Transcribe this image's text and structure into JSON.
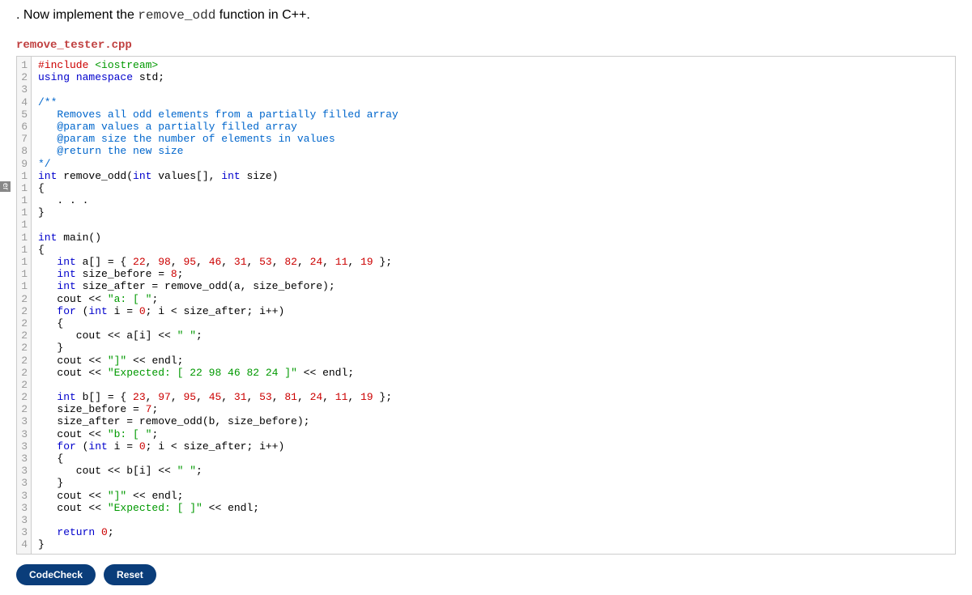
{
  "instruction_prefix": ". Now implement the ",
  "instruction_code": "remove_odd",
  "instruction_suffix": " function in C++.",
  "filename": "remove_tester.cpp",
  "sidebar_label": "er",
  "gutter_nums": [
    "1",
    "2",
    "3",
    "4",
    "5",
    "6",
    "7",
    "8",
    "9",
    "1",
    "1",
    "1",
    "1",
    "1",
    "1",
    "1",
    "1",
    "1",
    "1",
    "2",
    "2",
    "2",
    "2",
    "2",
    "2",
    "2",
    "2",
    "2",
    "2",
    "3",
    "3",
    "3",
    "3",
    "3",
    "3",
    "3",
    "3",
    "3",
    "3",
    "4"
  ],
  "code_lines": [
    {
      "segments": [
        {
          "text": "#include ",
          "cls": "kw-red"
        },
        {
          "text": "<iostream>",
          "cls": "kw-green"
        }
      ]
    },
    {
      "segments": [
        {
          "text": "using",
          "cls": "kw-blue"
        },
        {
          "text": " ",
          "cls": ""
        },
        {
          "text": "namespace",
          "cls": "kw-blue"
        },
        {
          "text": " std;",
          "cls": ""
        }
      ]
    },
    {
      "segments": []
    },
    {
      "segments": [
        {
          "text": "/**",
          "cls": "comment-blue"
        }
      ]
    },
    {
      "segments": [
        {
          "text": "   Removes all odd elements from a partially filled array",
          "cls": "comment-blue"
        }
      ]
    },
    {
      "segments": [
        {
          "text": "   @param values a partially filled array",
          "cls": "comment-blue"
        }
      ]
    },
    {
      "segments": [
        {
          "text": "   @param size the number of elements in values",
          "cls": "comment-blue"
        }
      ]
    },
    {
      "segments": [
        {
          "text": "   @return the new size",
          "cls": "comment-blue"
        }
      ]
    },
    {
      "segments": [
        {
          "text": "*/",
          "cls": "comment-blue"
        }
      ]
    },
    {
      "segments": [
        {
          "text": "int",
          "cls": "kw-blue"
        },
        {
          "text": " remove_odd(",
          "cls": ""
        },
        {
          "text": "int",
          "cls": "kw-blue"
        },
        {
          "text": " values[], ",
          "cls": ""
        },
        {
          "text": "int",
          "cls": "kw-blue"
        },
        {
          "text": " size)",
          "cls": ""
        }
      ]
    },
    {
      "segments": [
        {
          "text": "{",
          "cls": ""
        }
      ]
    },
    {
      "segments": [
        {
          "text": "   . . .",
          "cls": ""
        }
      ]
    },
    {
      "segments": [
        {
          "text": "}",
          "cls": ""
        }
      ]
    },
    {
      "segments": []
    },
    {
      "segments": [
        {
          "text": "int",
          "cls": "kw-blue"
        },
        {
          "text": " main()",
          "cls": ""
        }
      ]
    },
    {
      "segments": [
        {
          "text": "{",
          "cls": ""
        }
      ]
    },
    {
      "segments": [
        {
          "text": "   ",
          "cls": ""
        },
        {
          "text": "int",
          "cls": "kw-blue"
        },
        {
          "text": " a[] = { ",
          "cls": ""
        },
        {
          "text": "22",
          "cls": "num-red"
        },
        {
          "text": ", ",
          "cls": ""
        },
        {
          "text": "98",
          "cls": "num-red"
        },
        {
          "text": ", ",
          "cls": ""
        },
        {
          "text": "95",
          "cls": "num-red"
        },
        {
          "text": ", ",
          "cls": ""
        },
        {
          "text": "46",
          "cls": "num-red"
        },
        {
          "text": ", ",
          "cls": ""
        },
        {
          "text": "31",
          "cls": "num-red"
        },
        {
          "text": ", ",
          "cls": ""
        },
        {
          "text": "53",
          "cls": "num-red"
        },
        {
          "text": ", ",
          "cls": ""
        },
        {
          "text": "82",
          "cls": "num-red"
        },
        {
          "text": ", ",
          "cls": ""
        },
        {
          "text": "24",
          "cls": "num-red"
        },
        {
          "text": ", ",
          "cls": ""
        },
        {
          "text": "11",
          "cls": "num-red"
        },
        {
          "text": ", ",
          "cls": ""
        },
        {
          "text": "19",
          "cls": "num-red"
        },
        {
          "text": " };",
          "cls": ""
        }
      ]
    },
    {
      "segments": [
        {
          "text": "   ",
          "cls": ""
        },
        {
          "text": "int",
          "cls": "kw-blue"
        },
        {
          "text": " size_before = ",
          "cls": ""
        },
        {
          "text": "8",
          "cls": "num-red"
        },
        {
          "text": ";",
          "cls": ""
        }
      ]
    },
    {
      "segments": [
        {
          "text": "   ",
          "cls": ""
        },
        {
          "text": "int",
          "cls": "kw-blue"
        },
        {
          "text": " size_after = remove_odd(a, size_before);",
          "cls": ""
        }
      ]
    },
    {
      "segments": [
        {
          "text": "   cout << ",
          "cls": ""
        },
        {
          "text": "\"a: [ \"",
          "cls": "kw-green"
        },
        {
          "text": ";",
          "cls": ""
        }
      ]
    },
    {
      "segments": [
        {
          "text": "   ",
          "cls": ""
        },
        {
          "text": "for",
          "cls": "kw-blue"
        },
        {
          "text": " (",
          "cls": ""
        },
        {
          "text": "int",
          "cls": "kw-blue"
        },
        {
          "text": " i = ",
          "cls": ""
        },
        {
          "text": "0",
          "cls": "num-red"
        },
        {
          "text": "; i < size_after; i++)",
          "cls": ""
        }
      ]
    },
    {
      "segments": [
        {
          "text": "   {",
          "cls": ""
        }
      ]
    },
    {
      "segments": [
        {
          "text": "      cout << a[i] << ",
          "cls": ""
        },
        {
          "text": "\" \"",
          "cls": "kw-green"
        },
        {
          "text": ";",
          "cls": ""
        }
      ]
    },
    {
      "segments": [
        {
          "text": "   }",
          "cls": ""
        }
      ]
    },
    {
      "segments": [
        {
          "text": "   cout << ",
          "cls": ""
        },
        {
          "text": "\"]\"",
          "cls": "kw-green"
        },
        {
          "text": " << endl;",
          "cls": ""
        }
      ]
    },
    {
      "segments": [
        {
          "text": "   cout << ",
          "cls": ""
        },
        {
          "text": "\"Expected: [ 22 98 46 82 24 ]\"",
          "cls": "kw-green"
        },
        {
          "text": " << endl;",
          "cls": ""
        }
      ]
    },
    {
      "segments": []
    },
    {
      "segments": [
        {
          "text": "   ",
          "cls": ""
        },
        {
          "text": "int",
          "cls": "kw-blue"
        },
        {
          "text": " b[] = { ",
          "cls": ""
        },
        {
          "text": "23",
          "cls": "num-red"
        },
        {
          "text": ", ",
          "cls": ""
        },
        {
          "text": "97",
          "cls": "num-red"
        },
        {
          "text": ", ",
          "cls": ""
        },
        {
          "text": "95",
          "cls": "num-red"
        },
        {
          "text": ", ",
          "cls": ""
        },
        {
          "text": "45",
          "cls": "num-red"
        },
        {
          "text": ", ",
          "cls": ""
        },
        {
          "text": "31",
          "cls": "num-red"
        },
        {
          "text": ", ",
          "cls": ""
        },
        {
          "text": "53",
          "cls": "num-red"
        },
        {
          "text": ", ",
          "cls": ""
        },
        {
          "text": "81",
          "cls": "num-red"
        },
        {
          "text": ", ",
          "cls": ""
        },
        {
          "text": "24",
          "cls": "num-red"
        },
        {
          "text": ", ",
          "cls": ""
        },
        {
          "text": "11",
          "cls": "num-red"
        },
        {
          "text": ", ",
          "cls": ""
        },
        {
          "text": "19",
          "cls": "num-red"
        },
        {
          "text": " };",
          "cls": ""
        }
      ]
    },
    {
      "segments": [
        {
          "text": "   size_before = ",
          "cls": ""
        },
        {
          "text": "7",
          "cls": "num-red"
        },
        {
          "text": ";",
          "cls": ""
        }
      ]
    },
    {
      "segments": [
        {
          "text": "   size_after = remove_odd(b, size_before);",
          "cls": ""
        }
      ]
    },
    {
      "segments": [
        {
          "text": "   cout << ",
          "cls": ""
        },
        {
          "text": "\"b: [ \"",
          "cls": "kw-green"
        },
        {
          "text": ";",
          "cls": ""
        }
      ]
    },
    {
      "segments": [
        {
          "text": "   ",
          "cls": ""
        },
        {
          "text": "for",
          "cls": "kw-blue"
        },
        {
          "text": " (",
          "cls": ""
        },
        {
          "text": "int",
          "cls": "kw-blue"
        },
        {
          "text": " i = ",
          "cls": ""
        },
        {
          "text": "0",
          "cls": "num-red"
        },
        {
          "text": "; i < size_after; i++)",
          "cls": ""
        }
      ]
    },
    {
      "segments": [
        {
          "text": "   {",
          "cls": ""
        }
      ]
    },
    {
      "segments": [
        {
          "text": "      cout << b[i] << ",
          "cls": ""
        },
        {
          "text": "\" \"",
          "cls": "kw-green"
        },
        {
          "text": ";",
          "cls": ""
        }
      ]
    },
    {
      "segments": [
        {
          "text": "   }",
          "cls": ""
        }
      ]
    },
    {
      "segments": [
        {
          "text": "   cout << ",
          "cls": ""
        },
        {
          "text": "\"]\"",
          "cls": "kw-green"
        },
        {
          "text": " << endl;",
          "cls": ""
        }
      ]
    },
    {
      "segments": [
        {
          "text": "   cout << ",
          "cls": ""
        },
        {
          "text": "\"Expected: [ ]\"",
          "cls": "kw-green"
        },
        {
          "text": " << endl;",
          "cls": ""
        }
      ]
    },
    {
      "segments": []
    },
    {
      "segments": [
        {
          "text": "   ",
          "cls": ""
        },
        {
          "text": "return",
          "cls": "kw-blue"
        },
        {
          "text": " ",
          "cls": ""
        },
        {
          "text": "0",
          "cls": "num-red"
        },
        {
          "text": ";",
          "cls": ""
        }
      ]
    },
    {
      "segments": [
        {
          "text": "}",
          "cls": ""
        }
      ]
    }
  ],
  "buttons": {
    "codecheck": "CodeCheck",
    "reset": "Reset"
  }
}
